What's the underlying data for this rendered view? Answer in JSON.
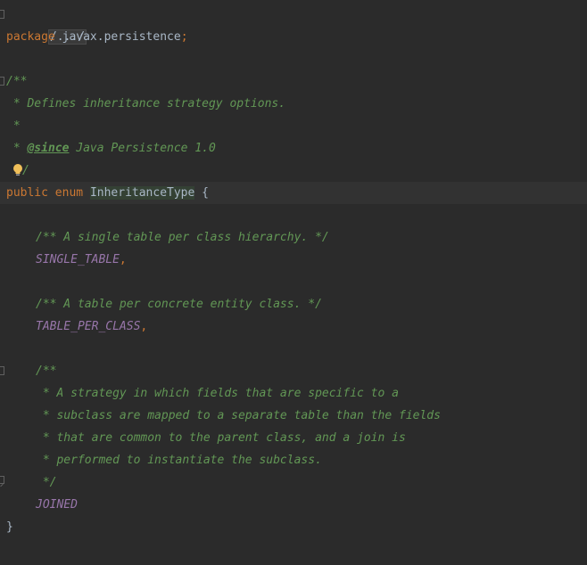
{
  "editor": {
    "lines": {
      "l1": {
        "folded": "/.../"
      },
      "l2": {
        "kw": "package",
        "name": " javax.persistence",
        "semi": ";"
      },
      "l4": {
        "text": "/**"
      },
      "l5": {
        "text": " * Defines inheritance strategy options."
      },
      "l6": {
        "text": " *"
      },
      "l7": {
        "prefix": " * ",
        "tag": "@since",
        "rest": " Java Persistence 1.0"
      },
      "l8": {
        "text": "/"
      },
      "l9": {
        "kw1": "public",
        "kw2": " enum ",
        "name": "InheritanceType",
        "rest": " {"
      },
      "l11": {
        "text": "/** A single table per class hierarchy. */"
      },
      "l12": {
        "const": "SINGLE_TABLE",
        "sep": ","
      },
      "l14": {
        "text": "/** A table per concrete entity class. */"
      },
      "l15": {
        "const": "TABLE_PER_CLASS",
        "sep": ","
      },
      "l17": {
        "text": "/**"
      },
      "l18": {
        "text": " * A strategy in which fields that are specific to a"
      },
      "l19": {
        "text": " * subclass are mapped to a separate table than the fields"
      },
      "l20": {
        "text": " * that are common to the parent class, and a join is"
      },
      "l21": {
        "text": " * performed to instantiate the subclass."
      },
      "l22": {
        "text": " */"
      },
      "l23": {
        "const": "JOINED"
      },
      "l24": {
        "text": "}"
      }
    },
    "colors": {
      "background": "#2b2b2b",
      "keyword": "#cc7832",
      "text": "#a9b7c6",
      "doc_comment": "#629755",
      "constant": "#9876aa"
    },
    "icons": {
      "intention": "lightbulb-icon",
      "fold": "fold-marker-icon"
    }
  }
}
